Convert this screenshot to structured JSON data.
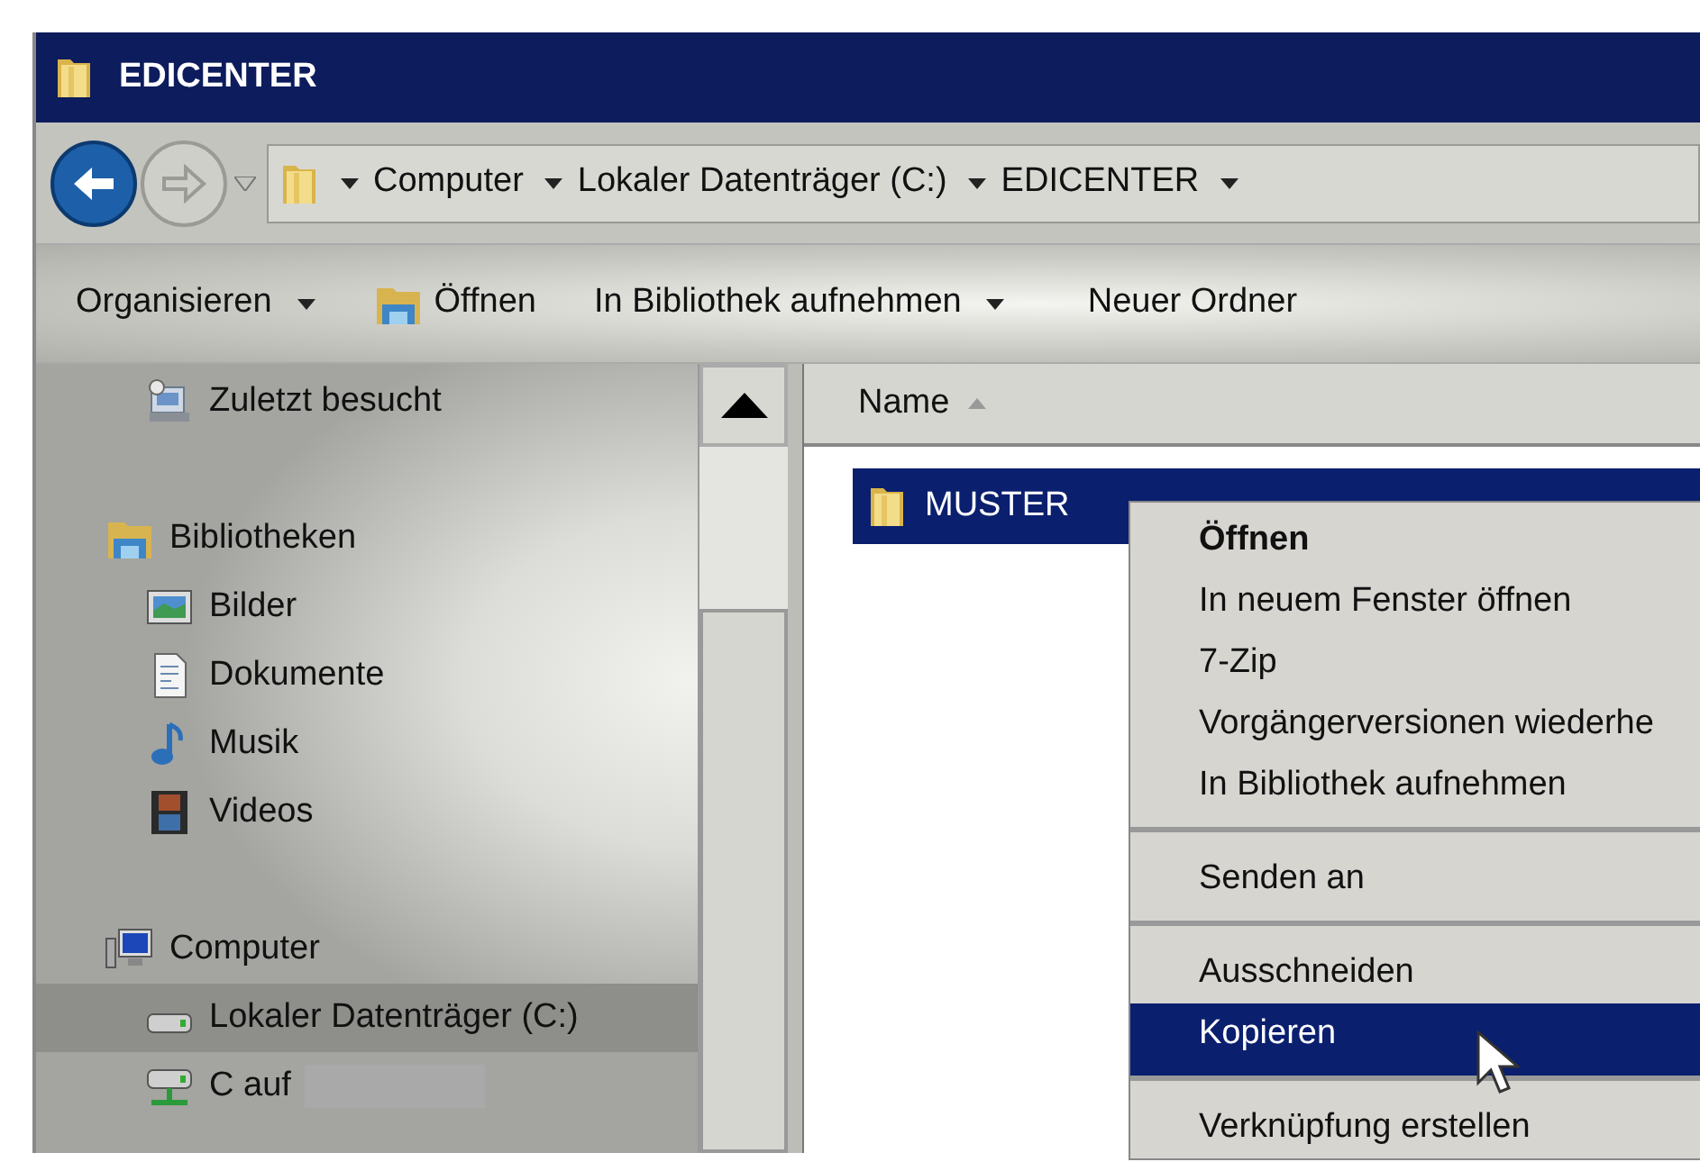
{
  "window": {
    "title": "EDICENTER"
  },
  "address_bar": {
    "crumbs": [
      "Computer",
      "Lokaler Datenträger (C:)",
      "EDICENTER"
    ]
  },
  "toolbar": [
    {
      "label": "Organisieren",
      "kind": "dropdown"
    },
    {
      "label": "Öffnen",
      "kind": "icon"
    },
    {
      "label": "In Bibliothek aufnehmen",
      "kind": "dropdown"
    },
    {
      "label": "Neuer Ordner",
      "kind": "plain"
    }
  ],
  "sidebar": {
    "groups": [
      {
        "items": [
          {
            "label": "Zuletzt besucht",
            "kind": "recent",
            "selected": false
          }
        ]
      },
      {
        "label": "Bibliotheken",
        "kind": "library",
        "items": [
          {
            "label": "Bilder",
            "kind": "pictures",
            "selected": false
          },
          {
            "label": "Dokumente",
            "kind": "documents",
            "selected": false
          },
          {
            "label": "Musik",
            "kind": "music",
            "selected": false
          },
          {
            "label": "Videos",
            "kind": "videos",
            "selected": false
          }
        ]
      },
      {
        "label": "Computer",
        "kind": "computer",
        "items": [
          {
            "label": "Lokaler Datenträger (C:)",
            "kind": "drive",
            "selected": true
          },
          {
            "label": "C auf",
            "kind": "network",
            "selected": false
          }
        ]
      }
    ]
  },
  "file_list": {
    "columns": [
      "Name"
    ],
    "rows": [
      {
        "name": "MUSTER",
        "selected": true
      }
    ]
  },
  "context_menu": {
    "items": [
      {
        "label": "Öffnen",
        "default": true,
        "selected": false,
        "separator_after": false
      },
      {
        "label": "In neuem Fenster öffnen",
        "default": false,
        "selected": false,
        "separator_after": false
      },
      {
        "label": "7-Zip",
        "default": false,
        "selected": false,
        "separator_after": false
      },
      {
        "label": "Vorgängerversionen wiederhe",
        "default": false,
        "selected": false,
        "separator_after": false
      },
      {
        "label": "In Bibliothek aufnehmen",
        "default": false,
        "selected": false,
        "separator_after": true
      },
      {
        "label": "Senden an",
        "default": false,
        "selected": false,
        "separator_after": true
      },
      {
        "label": "Ausschneiden",
        "default": false,
        "selected": false,
        "separator_after": false
      },
      {
        "label": "Kopieren",
        "default": false,
        "selected": true,
        "separator_after": true
      },
      {
        "label": "Verknüpfung erstellen",
        "default": false,
        "selected": false,
        "separator_after": false
      }
    ]
  }
}
